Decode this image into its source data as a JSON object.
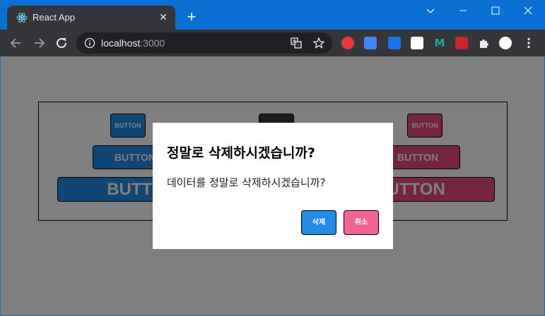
{
  "browser": {
    "tab_title": "React App",
    "tab_close": "✕",
    "new_tab": "+",
    "url_host": "localhost",
    "url_port": ":3000",
    "icons": [
      "react-favicon",
      "back-arrow",
      "forward-arrow",
      "reload",
      "info",
      "translate",
      "star",
      "puzzle-extensions",
      "profile",
      "menu-dots"
    ]
  },
  "page": {
    "rows": [
      {
        "buttons": [
          {
            "label": "BUTTON",
            "color": "blue"
          },
          {
            "label": "",
            "color": "gray"
          },
          {
            "label": "BUTTON",
            "color": "pink"
          }
        ]
      },
      {
        "buttons": [
          {
            "label": "BUTTON",
            "color": "blue"
          },
          {
            "label": "BUTTON",
            "color": "pink"
          }
        ]
      },
      {
        "buttons": [
          {
            "label": "BUTTON",
            "color": "blue"
          },
          {
            "label": "BUTTON",
            "color": "pink"
          }
        ]
      }
    ]
  },
  "dialog": {
    "title": "정말로 삭제하시겠습니까?",
    "description": "데이터를 정말로 삭제하시겠습니까?",
    "confirm_label": "삭제",
    "cancel_label": "취소"
  },
  "colors": {
    "blue": "#228be6",
    "gray": "#343a40",
    "pink": "#e64980",
    "cancel_pink": "#f06595",
    "chrome_blue": "#0a70d4",
    "chrome_dark": "#35363a"
  }
}
